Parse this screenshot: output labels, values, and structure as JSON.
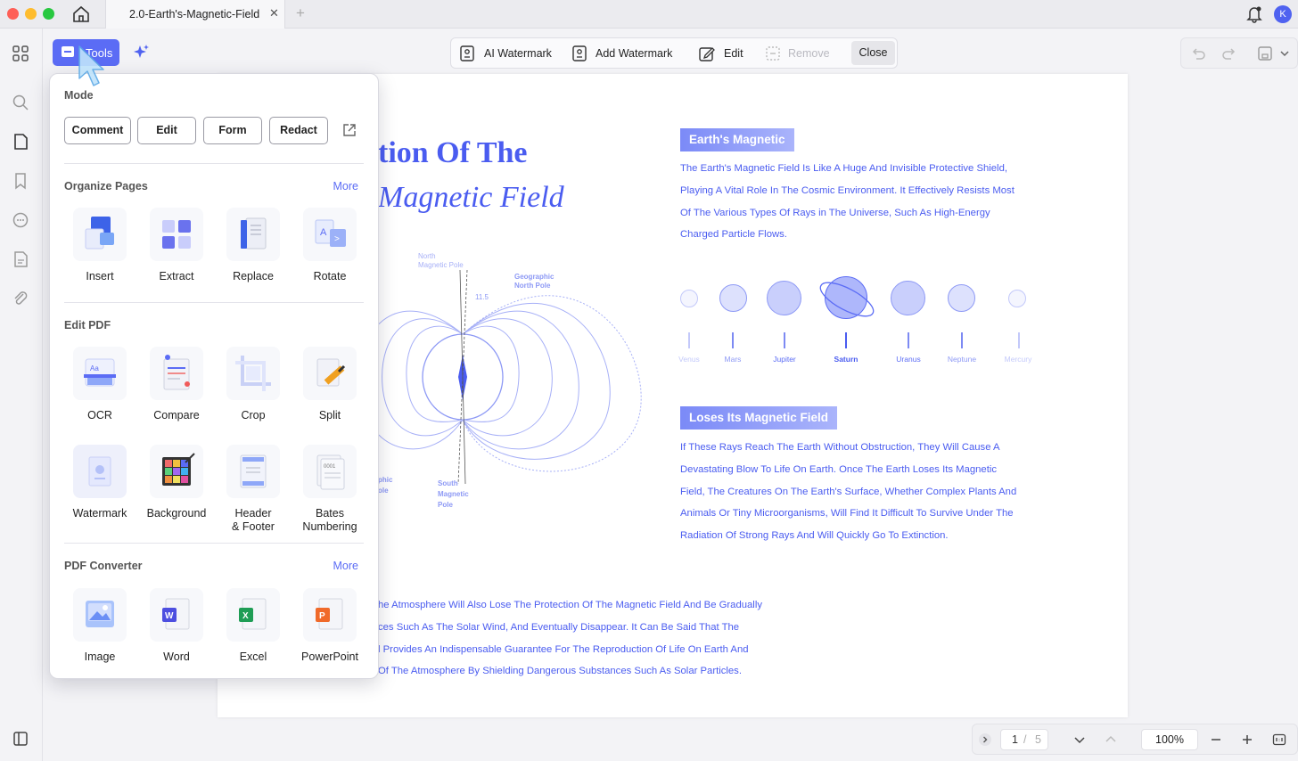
{
  "tab": {
    "title": "2.0-Earth's-Magnetic-Field",
    "close": "✕",
    "new": "+"
  },
  "user": {
    "initial": "K"
  },
  "toolbar": {
    "tools_label": "Tools",
    "ai_watermark": "AI Watermark",
    "add_watermark": "Add Watermark",
    "edit": "Edit",
    "remove": "Remove",
    "close": "Close"
  },
  "panel": {
    "mode_title": "Mode",
    "modes": [
      "Comment",
      "Edit",
      "Form",
      "Redact"
    ],
    "organize": {
      "title": "Organize Pages",
      "more": "More",
      "items": [
        "Insert",
        "Extract",
        "Replace",
        "Rotate"
      ]
    },
    "edit_pdf": {
      "title": "Edit PDF",
      "items": [
        "OCR",
        "Compare",
        "Crop",
        "Split",
        "Watermark",
        "Background",
        "Header\n& Footer",
        "Bates\nNumbering"
      ]
    },
    "converter": {
      "title": "PDF Converter",
      "more": "More",
      "items": [
        "Image",
        "Word",
        "Excel",
        "PowerPoint"
      ]
    }
  },
  "document": {
    "heading_1": "tion Of The",
    "heading_2": "Magnetic Field",
    "section_1": {
      "tag": "Earth's Magnetic",
      "lines": [
        "The Earth's Magnetic Field Is Like A Huge And Invisible Protective Shield,",
        "Playing A Vital Role In The Cosmic Environment. It Effectively Resists Most",
        "Of The Various Types Of Rays in The Universe, Such As High-Energy",
        "Charged Particle Flows."
      ]
    },
    "planets": [
      "Venus",
      "Mars",
      "Jupiter",
      "Saturn",
      "Uranus",
      "Neptune",
      "Mercury"
    ],
    "section_2": {
      "tag": "Loses Its Magnetic Field",
      "lines": [
        "If These Rays Reach The Earth Without Obstruction, They Will Cause A",
        "Devastating Blow To Life On Earth. Once The Earth Loses Its Magnetic",
        "Field, The Creatures On The Earth's Surface, Whether Complex Plants And",
        "Animals Or Tiny Microorganisms, Will Find It Difficult To Survive Under The",
        "Radiation Of Strong Rays And Will Quickly Go To Extinction."
      ]
    },
    "diagram_labels": {
      "north_magnetic": "North\nMagnetic Pole",
      "geo_north": "Geographic\nNorth Pole",
      "angle": "11.5",
      "south_magnetic": "South\nMagnetic\nPole",
      "geo_south": "phic\nole"
    },
    "bottom_lines": [
      "he Atmosphere Will Also Lose The Protection Of The Magnetic Field And Be Gradually",
      "ces Such As The Solar Wind, And Eventually Disappear. It Can Be Said That The",
      "l Provides An Indispensable Guarantee For The Reproduction Of Life On Earth And",
      "Of The Atmosphere By Shielding Dangerous Substances Such As Solar Particles."
    ]
  },
  "navigation": {
    "current_page": "1",
    "separator": "/",
    "total_pages": "5",
    "zoom": "100%"
  },
  "colors": {
    "accent": "#5b6cf5",
    "doc_blue": "#4a5cf0"
  }
}
